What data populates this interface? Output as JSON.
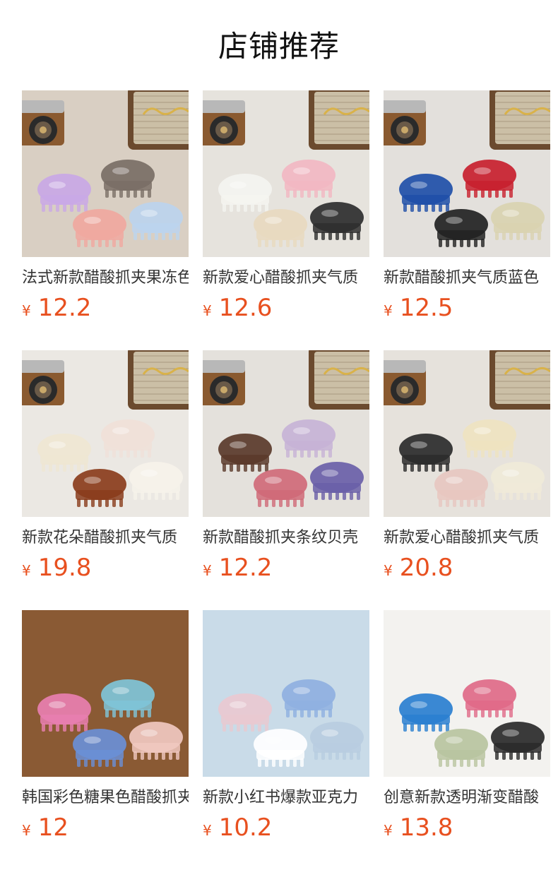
{
  "page": {
    "title": "店铺推荐"
  },
  "products": [
    {
      "name": "法式新款醋酸抓夹果冻色",
      "currency": "¥",
      "price": "12.2",
      "image": "pastel-claw-clips-camera-speaker",
      "bg": "#d9cfc3",
      "accent": [
        "#c9a8e6",
        "#7a6f66",
        "#f0a8a0",
        "#bcd4ee"
      ]
    },
    {
      "name": "新款爱心醋酸抓夹气质",
      "currency": "¥",
      "price": "12.6",
      "image": "heart-claw-clips-camera-speaker",
      "bg": "#e6e3dd",
      "accent": [
        "#f4f4f0",
        "#f2b7c2",
        "#e8d9bf",
        "#2e2e2e"
      ]
    },
    {
      "name": "新款醋酸抓夹气质蓝色",
      "currency": "¥",
      "price": "12.5",
      "image": "triangle-claw-clips-camera-speaker",
      "bg": "#e3e0dc",
      "accent": [
        "#1f4fa8",
        "#c8202e",
        "#222222",
        "#d9d2b0"
      ]
    },
    {
      "name": "新款花朵醋酸抓夹气质",
      "currency": "¥",
      "price": "19.8",
      "image": "flower-claw-clips-camera-speaker",
      "bg": "#ebe8e3",
      "accent": [
        "#efe6d2",
        "#f0e0d8",
        "#8a3c1c",
        "#f6f2ea"
      ]
    },
    {
      "name": "新款醋酸抓夹条纹贝壳",
      "currency": "¥",
      "price": "12.2",
      "image": "patterned-claw-clips-camera-speaker",
      "bg": "#e4e1dc",
      "accent": [
        "#5a3a2a",
        "#c7b3d6",
        "#d06a78",
        "#6a5fa8"
      ]
    },
    {
      "name": "新款爱心醋酸抓夹气质",
      "currency": "¥",
      "price": "20.8",
      "image": "butterfly-claw-clips-camera-speaker",
      "bg": "#e6e2dc",
      "accent": [
        "#2b2b2b",
        "#efe3c0",
        "#e7c7c0",
        "#f0ead8"
      ]
    },
    {
      "name": "韩国彩色糖果色醋酸抓夹",
      "currency": "¥",
      "price": "12",
      "image": "candy-claw-clips-on-mirror-bench",
      "bg": "#8a5a34",
      "accent": [
        "#e87fb0",
        "#7fc4d8",
        "#6a8fd6",
        "#f0c8c0"
      ]
    },
    {
      "name": "新款小红书爆款亚克力",
      "currency": "¥",
      "price": "10.2",
      "image": "fishtail-claw-clips-white-wall",
      "bg": "#c9dbe8",
      "accent": [
        "#e9c9d0",
        "#8fb0e0",
        "#ffffff",
        "#b8cde0"
      ]
    },
    {
      "name": "创意新款透明渐变醋酸",
      "currency": "¥",
      "price": "13.8",
      "image": "gradient-claw-clips-on-white",
      "bg": "#f3f2ef",
      "accent": [
        "#2a7fd0",
        "#e06a88",
        "#b9c4a0",
        "#2a2a2a"
      ]
    }
  ]
}
